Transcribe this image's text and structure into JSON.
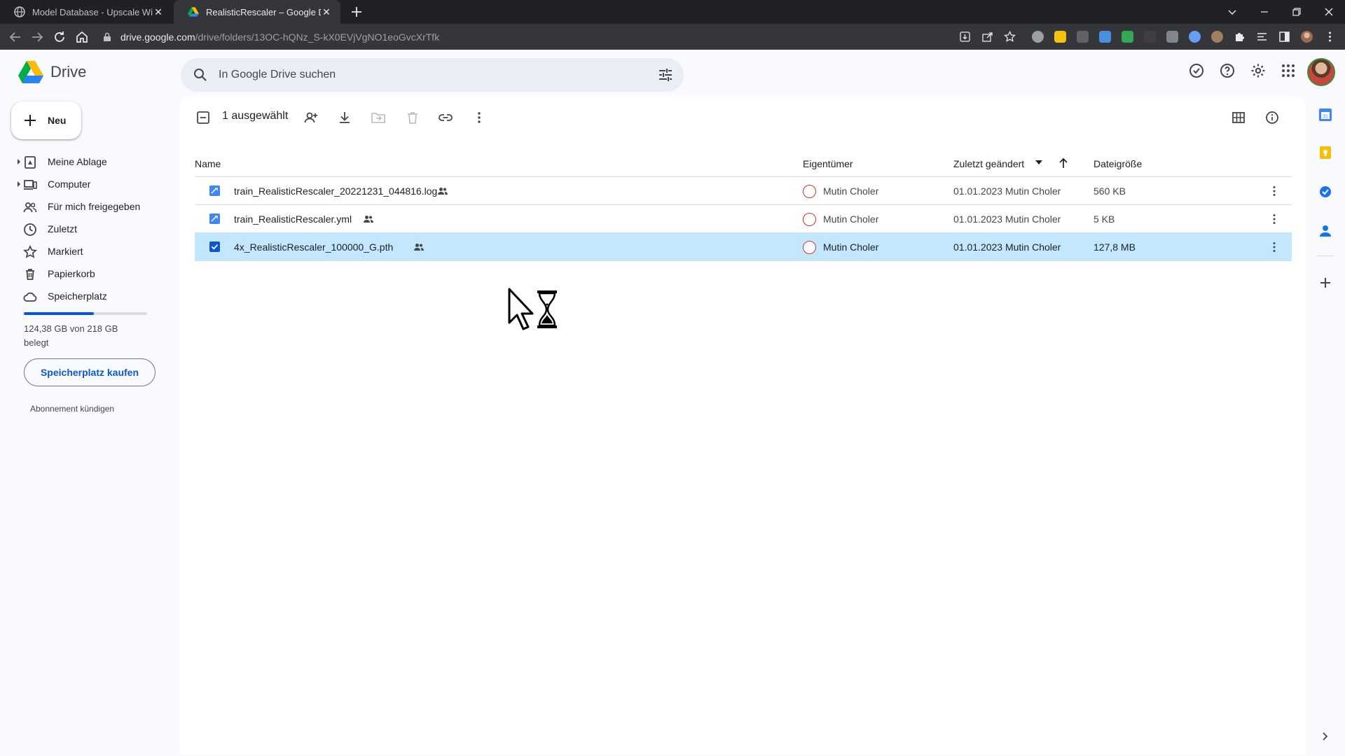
{
  "browser": {
    "tabs": [
      {
        "title": "Model Database - Upscale Wiki",
        "active": false
      },
      {
        "title": "RealisticRescaler – Google Drive",
        "active": true
      }
    ],
    "url_host": "drive.google.com",
    "url_path": "/drive/folders/13OC-hQNz_S-kX0EVjVgNO1eoGvcXrTfk"
  },
  "app": {
    "name": "Drive"
  },
  "search": {
    "placeholder": "In Google Drive suchen"
  },
  "sidebar": {
    "new_label": "Neu",
    "items": [
      {
        "label": "Meine Ablage",
        "icon": "my-drive-icon",
        "expandable": true
      },
      {
        "label": "Computer",
        "icon": "computer-icon",
        "expandable": true
      },
      {
        "label": "Für mich freigegeben",
        "icon": "shared-with-me-icon",
        "expandable": false
      },
      {
        "label": "Zuletzt",
        "icon": "clock-icon",
        "expandable": false
      },
      {
        "label": "Markiert",
        "icon": "star-icon",
        "expandable": false
      },
      {
        "label": "Papierkorb",
        "icon": "trash-icon",
        "expandable": false
      },
      {
        "label": "Speicherplatz",
        "icon": "cloud-icon",
        "expandable": false
      }
    ],
    "storage": {
      "used_fraction": 0.57,
      "text": "124,38 GB von 218 GB belegt",
      "buy_label": "Speicherplatz kaufen",
      "cancel_label": "Abonnement kündigen"
    }
  },
  "selection": {
    "count_label": "1 ausgewählt"
  },
  "table": {
    "headers": {
      "name": "Name",
      "owner": "Eigentümer",
      "modified": "Zuletzt geändert",
      "size": "Dateigröße"
    },
    "rows": [
      {
        "name": "train_RealisticRescaler_20221231_044816.log",
        "owner": "Mutin Choler",
        "modified": "01.01.2023 Mutin Choler",
        "size": "560 KB",
        "selected": false
      },
      {
        "name": "train_RealisticRescaler.yml",
        "owner": "Mutin Choler",
        "modified": "01.01.2023 Mutin Choler",
        "size": "5 KB",
        "selected": false
      },
      {
        "name": "4x_RealisticRescaler_100000_G.pth",
        "owner": "Mutin Choler",
        "modified": "01.01.2023 Mutin Choler",
        "size": "127,8 MB",
        "selected": true
      }
    ]
  },
  "colors": {
    "accent": "#0b57d0",
    "selected_row": "#c2e7ff",
    "background": "#f8fafd"
  }
}
